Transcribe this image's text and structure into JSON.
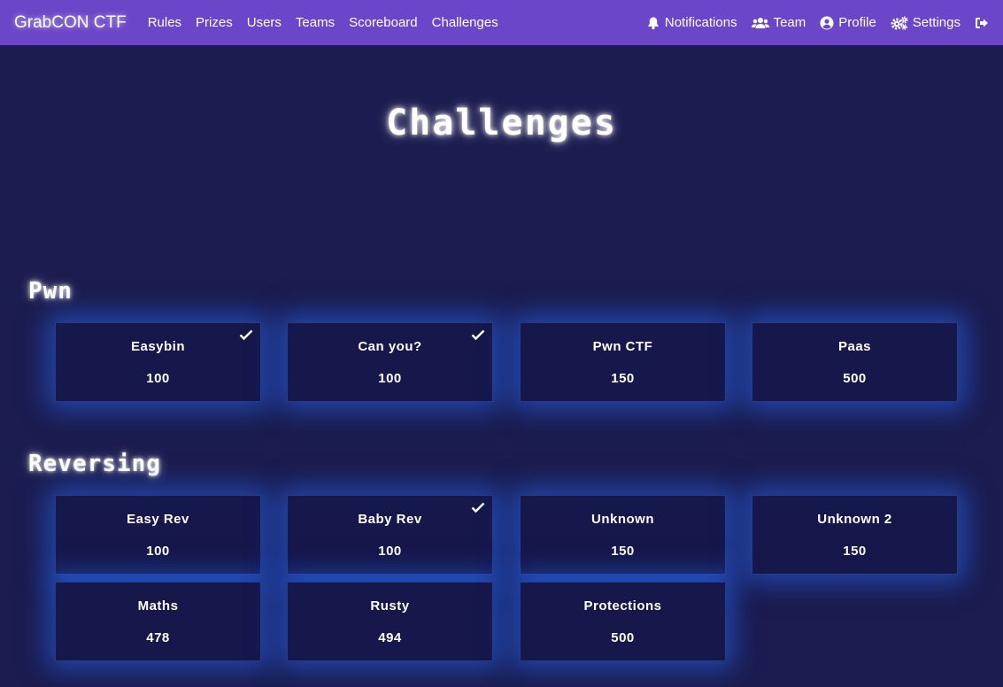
{
  "nav": {
    "brand": "GrabCON CTF",
    "links": [
      "Rules",
      "Prizes",
      "Users",
      "Teams",
      "Scoreboard",
      "Challenges"
    ],
    "right": {
      "notifications": "Notifications",
      "team": "Team",
      "profile": "Profile",
      "settings": "Settings"
    },
    "bg_color": "#6c46c8"
  },
  "page": {
    "title": "Challenges",
    "bg_color": "#1b1c4f",
    "glow_color": "#2a6eff"
  },
  "categories": [
    {
      "name": "Pwn",
      "challenges": [
        {
          "name": "Easybin",
          "value": "100",
          "solved": true
        },
        {
          "name": "Can you?",
          "value": "100",
          "solved": true
        },
        {
          "name": "Pwn CTF",
          "value": "150",
          "solved": false
        },
        {
          "name": "Paas",
          "value": "500",
          "solved": false
        }
      ]
    },
    {
      "name": "Reversing",
      "challenges": [
        {
          "name": "Easy Rev",
          "value": "100",
          "solved": false
        },
        {
          "name": "Baby Rev",
          "value": "100",
          "solved": true
        },
        {
          "name": "Unknown",
          "value": "150",
          "solved": false
        },
        {
          "name": "Unknown 2",
          "value": "150",
          "solved": false
        },
        {
          "name": "Maths",
          "value": "478",
          "solved": false
        },
        {
          "name": "Rusty",
          "value": "494",
          "solved": false
        },
        {
          "name": "Protections",
          "value": "500",
          "solved": false
        }
      ]
    }
  ]
}
